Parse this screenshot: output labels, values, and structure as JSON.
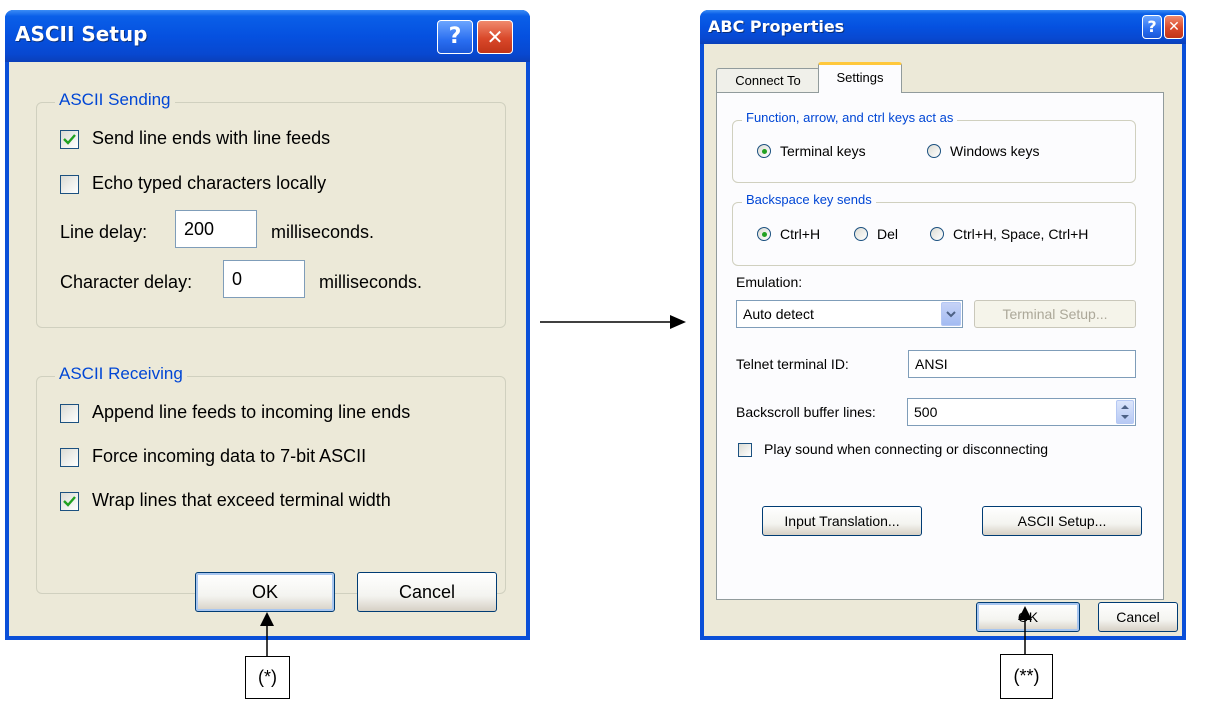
{
  "ascii_setup": {
    "title": "ASCII Setup",
    "help_glyph": "?",
    "close_glyph": "✕",
    "sending": {
      "title": "ASCII Sending",
      "send_line_ends": {
        "label": "Send line ends with line feeds",
        "checked": true
      },
      "echo_typed": {
        "label": "Echo typed characters locally",
        "checked": false
      },
      "line_delay_label": "Line delay:",
      "line_delay_value": "200",
      "line_delay_unit": "milliseconds.",
      "char_delay_label": "Character delay:",
      "char_delay_value": "0",
      "char_delay_unit": "milliseconds."
    },
    "receiving": {
      "title": "ASCII Receiving",
      "append_line_feeds": {
        "label": "Append line feeds to incoming line ends",
        "checked": false
      },
      "force_7bit": {
        "label": "Force incoming data to 7-bit ASCII",
        "checked": false
      },
      "wrap_lines": {
        "label": "Wrap lines that exceed terminal width",
        "checked": true
      }
    },
    "ok_label": "OK",
    "cancel_label": "Cancel"
  },
  "abc_properties": {
    "title": "ABC Properties",
    "help_glyph": "?",
    "close_glyph": "✕",
    "tabs": [
      {
        "label": "Connect To",
        "active": false
      },
      {
        "label": "Settings",
        "active": true
      }
    ],
    "keys_group": {
      "title": "Function, arrow, and ctrl keys act as",
      "options": [
        {
          "label": "Terminal keys",
          "selected": true
        },
        {
          "label": "Windows keys",
          "selected": false
        }
      ]
    },
    "backspace_group": {
      "title": "Backspace key sends",
      "options": [
        {
          "label": "Ctrl+H",
          "selected": true
        },
        {
          "label": "Del",
          "selected": false
        },
        {
          "label": "Ctrl+H, Space, Ctrl+H",
          "selected": false
        }
      ]
    },
    "emulation_label": "Emulation:",
    "emulation_value": "Auto detect",
    "terminal_setup_label": "Terminal Setup...",
    "telnet_id_label": "Telnet terminal ID:",
    "telnet_id_value": "ANSI",
    "backscroll_label": "Backscroll buffer lines:",
    "backscroll_value": "500",
    "play_sound": {
      "label": "Play sound when connecting or disconnecting",
      "checked": false
    },
    "input_translation_label": "Input Translation...",
    "ascii_setup_label": "ASCII Setup...",
    "ok_label": "OK",
    "cancel_label": "Cancel"
  },
  "annotations": {
    "marker_left": "(*)",
    "marker_right": "(**)"
  }
}
